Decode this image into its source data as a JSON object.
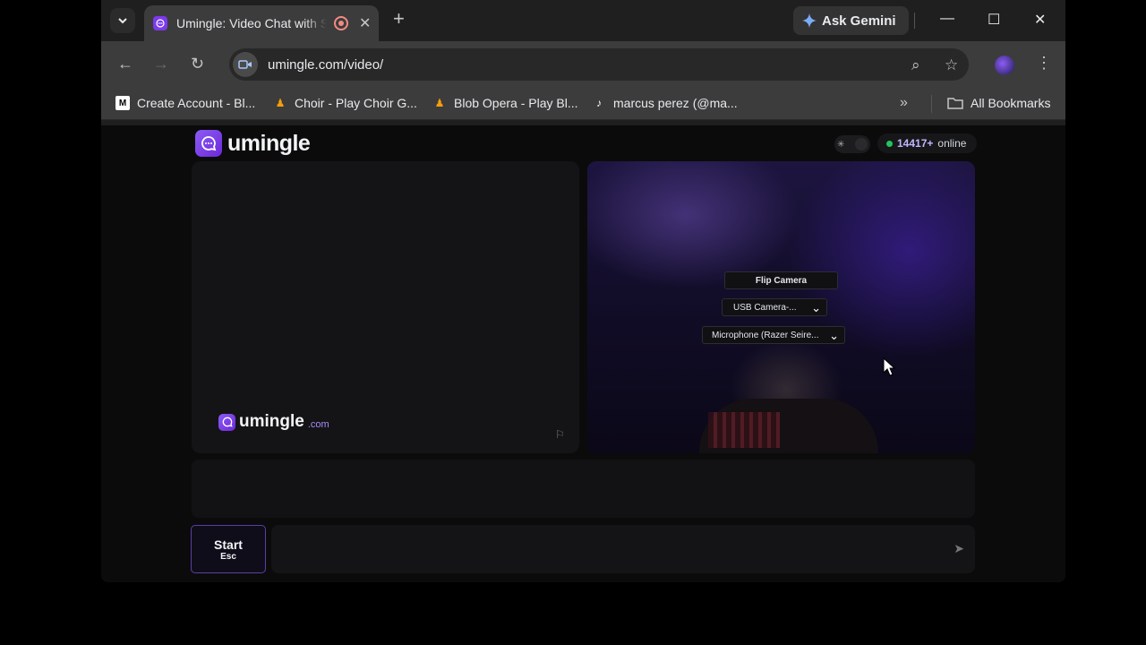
{
  "browser": {
    "tab_title": "Umingle: Video Chat with Strangers",
    "gemini_label": "Ask Gemini",
    "url": "umingle.com/video/",
    "bookmarks": [
      {
        "label": "Create Account - Bl...",
        "icon": "bluesky-icon"
      },
      {
        "label": "Choir - Play Choir G...",
        "icon": "choir-icon"
      },
      {
        "label": "Blob Opera - Play Bl...",
        "icon": "blob-opera-icon"
      },
      {
        "label": "marcus perez (@ma...",
        "icon": "tiktok-icon"
      }
    ],
    "all_bookmarks_label": "All Bookmarks"
  },
  "site": {
    "logo_text": "umingle",
    "online_count": "14417+",
    "online_label": "online",
    "watermark_text": "umingle",
    "watermark_tld": ".com",
    "controls": {
      "flip_camera": "Flip Camera",
      "camera_select": "USB Camera-...",
      "mic_select": "Microphone (Razer Seire..."
    },
    "start_label": "Start",
    "start_shortcut": "Esc",
    "message_placeholder": ""
  },
  "colors": {
    "brand": "#7c3aed",
    "online_dot": "#22c55e"
  }
}
